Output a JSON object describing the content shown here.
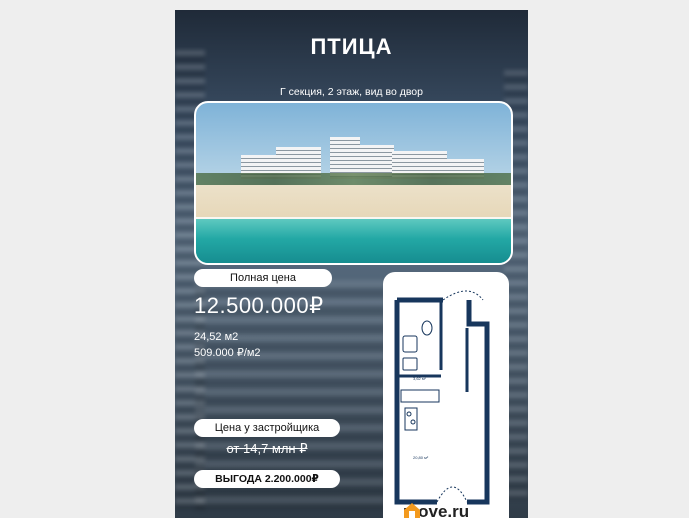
{
  "title": "ПТИЦА",
  "subtitle": "Г секция, 2 этаж, вид во двор",
  "full_price_label": "Полная цена",
  "price": "12.500.000₽",
  "area": "24,52 м2",
  "price_per_m2": "509.000 ₽/м2",
  "developer_price_label": "Цена у застройщика",
  "developer_price": "от 14,7 млн ₽",
  "savings": "ВЫГОДА 2.200.000₽",
  "plan": {
    "room1_area": "3,62 м²",
    "room2_area": "20,80 м²"
  },
  "logo": {
    "text": "move.ru",
    "icon": "house-logo-icon",
    "color": "#f39a1e"
  },
  "colors": {
    "plan_wall": "#17365c"
  }
}
